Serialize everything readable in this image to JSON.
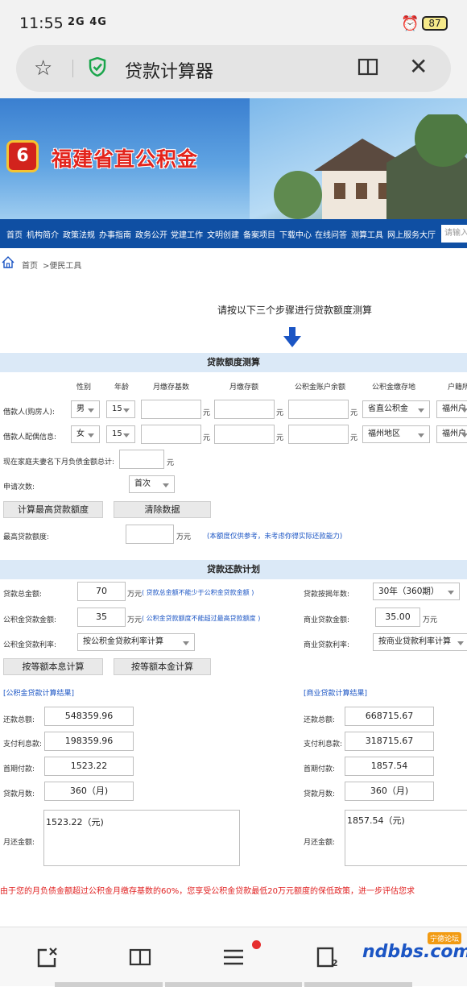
{
  "status": {
    "time": "11:55",
    "network": "2G 4G",
    "battery": "87"
  },
  "browser": {
    "page_title": "贷款计算器"
  },
  "banner": {
    "site_name": "福建省直公积金",
    "logo_char": "6"
  },
  "nav": {
    "items": [
      "首页",
      "机构简介",
      "政策法规",
      "办事指南",
      "政务公开",
      "党建工作",
      "文明创建",
      "备案项目",
      "下载中心",
      "在线问答",
      "测算工具",
      "网上服务大厅"
    ],
    "search_placeholder": "请输入"
  },
  "breadcrumb": {
    "home": "首页",
    "current": ">便民工具"
  },
  "intro": "请按以下三个步骤进行贷款额度测算",
  "section1": {
    "title": "贷款额度测算",
    "headers": [
      "性别",
      "年龄",
      "月缴存基数",
      "月缴存额",
      "公积金账户余额",
      "公积金缴存地",
      "户籍所"
    ],
    "rows": [
      {
        "label": "借款人(购房人):",
        "gender": "男",
        "age": "15",
        "unit": "元",
        "place": "省直公积金",
        "huji": "福州户"
      },
      {
        "label": "借款人配偶信息:",
        "gender": "女",
        "age": "15",
        "unit": "元",
        "place": "福州地区",
        "huji": "福州户"
      }
    ],
    "debt_label": "现在家庭夫妻名下月负债金额总计:",
    "debt_unit": "元",
    "times_label": "申请次数:",
    "times_value": "首次",
    "btn_calc": "计算最高贷款额度",
    "btn_clear": "清除数据",
    "max_label": "最高贷款额度:",
    "max_unit": "万元",
    "max_note": "(本额度仅供参考，未考虑你得实际还款能力)"
  },
  "section2": {
    "title": "贷款还款计划",
    "total_label": "贷款总金额:",
    "total_value": "70",
    "total_unit": "万元",
    "total_note": "( 贷款总金额不能少于公积金贷款金额 )",
    "years_label": "贷款按揭年数:",
    "years_value": "30年（360期）",
    "gjj_label": "公积金贷款金额:",
    "gjj_value": "35",
    "gjj_unit": "万元",
    "gjj_note": "( 公积金贷款额度不能超过最高贷款额度 )",
    "com_label": "商业贷款金额:",
    "com_value": "35.00",
    "com_unit": "万元",
    "gjj_rate_label": "公积金贷款利率:",
    "gjj_rate_value": "按公积金贷款利率计算",
    "com_rate_label": "商业贷款利率:",
    "com_rate_value": "按商业贷款利率计算",
    "btn_equal_interest": "按等额本息计算",
    "btn_equal_principal": "按等额本金计算",
    "gjj_result_title": "[公积金贷款计算结果]",
    "com_result_title": "[商业贷款计算结果]",
    "result_labels": [
      "还款总额:",
      "支付利息款:",
      "首期付款:",
      "贷款月数:",
      "月还金额:"
    ],
    "gjj_results": {
      "total": "548359.96",
      "interest": "198359.96",
      "first": "1523.22",
      "months": "360（月)",
      "monthly": "1523.22（元)"
    },
    "com_results": {
      "total": "668715.67",
      "interest": "318715.67",
      "first": "1857.54",
      "months": "360（月)",
      "monthly": "1857.54（元)"
    }
  },
  "notice": "由于您的月负债金额超过公积金月缴存基数的60%，您享受公积金贷款最低20万元额度的保低政策，进一步评估您求",
  "bottom": {
    "watermark": "ndbbs.com",
    "watermark_tag": "宁德论坛"
  }
}
